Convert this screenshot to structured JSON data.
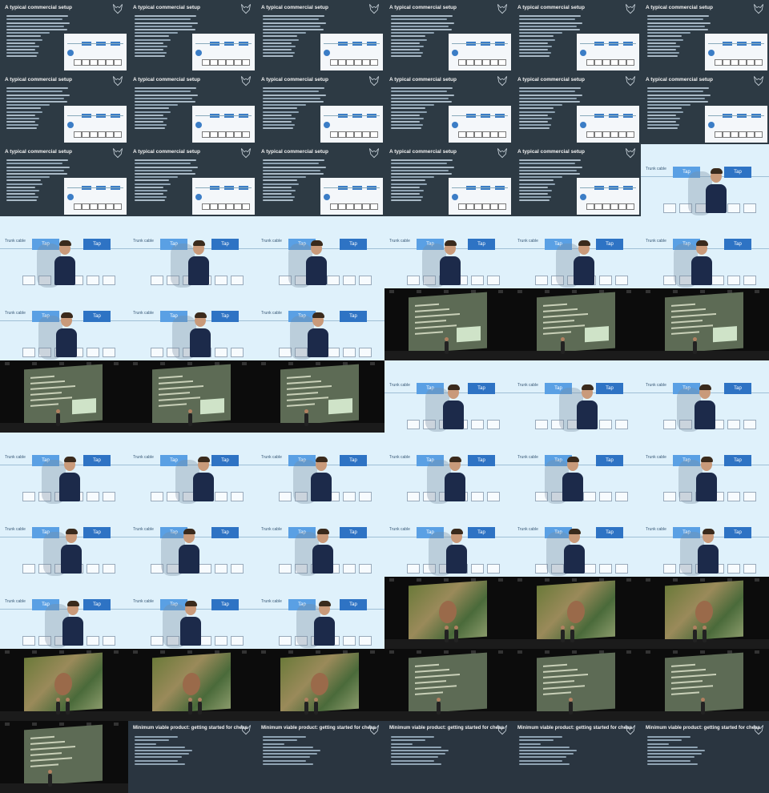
{
  "slide_commercial": {
    "title": "A typical commercial setup"
  },
  "slide_mvp": {
    "title": "Minimum viable product: getting started for cheap"
  },
  "closeup": {
    "trunk_label": "Trunk cable",
    "tap_label": "Tap"
  },
  "frames": [
    "slide",
    "slide",
    "slide",
    "slide",
    "slide",
    "slide",
    "slide",
    "slide",
    "slide",
    "slide",
    "slide",
    "slide",
    "slide",
    "slide",
    "slide",
    "slide",
    "slide",
    "close",
    "close",
    "close",
    "close",
    "close",
    "close",
    "close",
    "close",
    "close",
    "close",
    "wide-slide",
    "wide-slide",
    "wide-slide",
    "wide-slide",
    "wide-slide",
    "wide-slide",
    "close",
    "close",
    "close",
    "close",
    "close",
    "close",
    "close",
    "close",
    "close",
    "close",
    "close",
    "close",
    "close",
    "close",
    "close",
    "close",
    "close",
    "close",
    "wide-poster",
    "wide-poster",
    "wide-poster",
    "wide-poster",
    "wide-poster",
    "wide-poster",
    "wide-mvp",
    "wide-mvp",
    "wide-mvp",
    "wide-mvp",
    "mvp",
    "mvp",
    "mvp",
    "mvp",
    "mvp"
  ],
  "colors": {
    "slide_bg": "#2d3a44",
    "tap_blue": "#2e73c4",
    "closeup_bg": "#dff1fb",
    "shirt": "#1c2a4a"
  }
}
